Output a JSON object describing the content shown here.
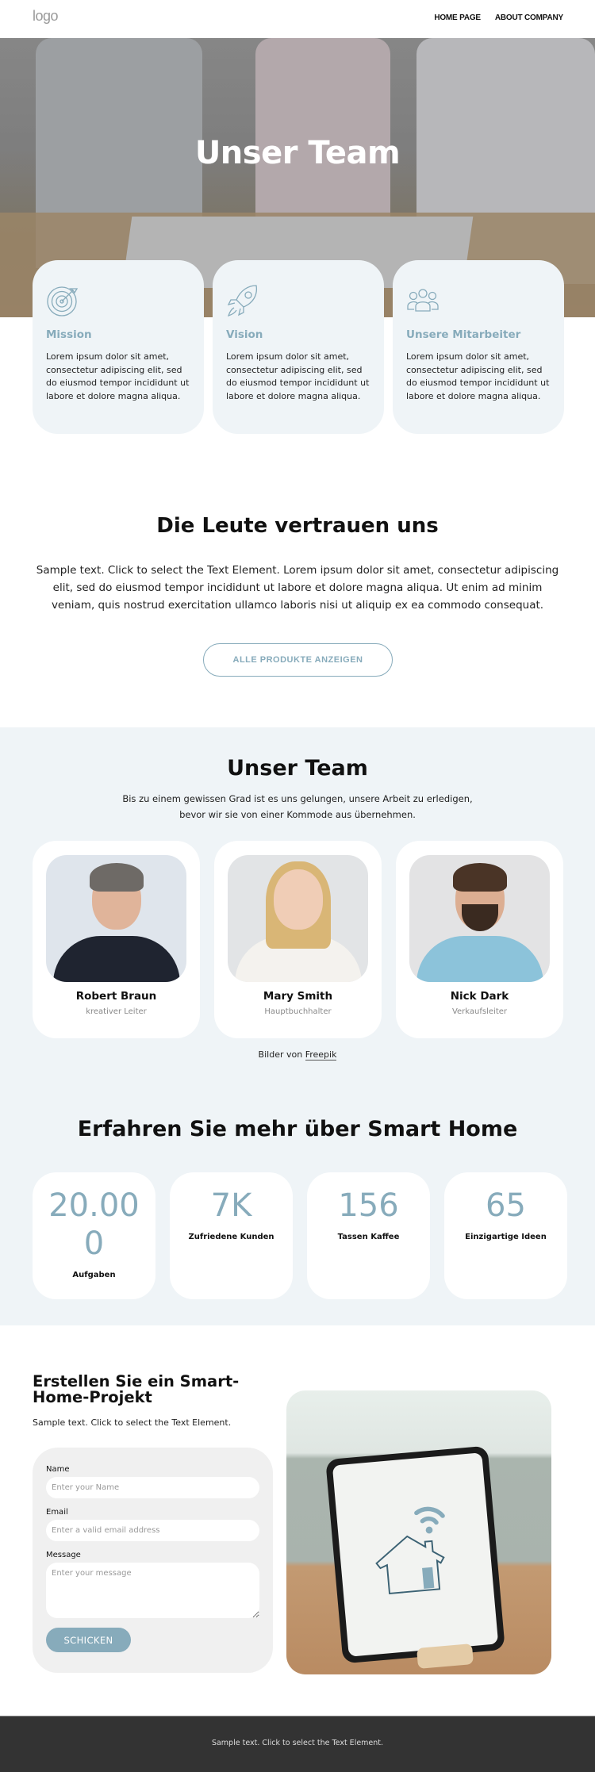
{
  "header": {
    "logo": "logo",
    "nav": [
      {
        "label": "HOME PAGE"
      },
      {
        "label": "ABOUT COMPANY"
      }
    ]
  },
  "hero": {
    "title": "Unser Team"
  },
  "features": [
    {
      "icon": "target-icon",
      "title": "Mission",
      "text": "Lorem ipsum dolor sit amet, consectetur adipiscing elit, sed do eiusmod tempor incididunt ut labore et dolore magna aliqua."
    },
    {
      "icon": "rocket-icon",
      "title": "Vision",
      "text": "Lorem ipsum dolor sit amet, consectetur adipiscing elit, sed do eiusmod tempor incididunt ut labore et dolore magna aliqua."
    },
    {
      "icon": "people-icon",
      "title": "Unsere Mitarbeiter",
      "text": "Lorem ipsum dolor sit amet, consectetur adipiscing elit, sed do eiusmod tempor incididunt ut labore et dolore magna aliqua."
    }
  ],
  "trust": {
    "title": "Die Leute vertrauen uns",
    "text": "Sample text. Click to select the Text Element. Lorem ipsum dolor sit amet, consectetur adipiscing elit, sed do eiusmod tempor incididunt ut labore et dolore magna aliqua. Ut enim ad minim veniam, quis nostrud exercitation ullamco laboris nisi ut aliquip ex ea commodo consequat.",
    "button_label": "ALLE PRODUKTE ANZEIGEN"
  },
  "team": {
    "title": "Unser Team",
    "subtitle": "Bis zu einem gewissen Grad ist es uns gelungen, unsere Arbeit zu erledigen, bevor wir sie von einer Kommode aus übernehmen.",
    "members": [
      {
        "name": "Robert Braun",
        "role": "kreativer Leiter"
      },
      {
        "name": "Mary Smith",
        "role": "Hauptbuchhalter"
      },
      {
        "name": "Nick Dark",
        "role": "Verkaufsleiter"
      }
    ],
    "credit_prefix": "Bilder von ",
    "credit_link": "Freepik"
  },
  "stats": {
    "title": "Erfahren Sie mehr über Smart Home",
    "items": [
      {
        "value": "20.000",
        "label": "Aufgaben"
      },
      {
        "value": "7K",
        "label": "Zufriedene Kunden"
      },
      {
        "value": "156",
        "label": "Tassen Kaffee"
      },
      {
        "value": "65",
        "label": "Einzigartige Ideen"
      }
    ]
  },
  "contact": {
    "title": "Erstellen Sie ein Smart-Home-Projekt",
    "subtitle": "Sample text. Click to select the Text Element.",
    "form": {
      "name_label": "Name",
      "name_placeholder": "Enter your Name",
      "email_label": "Email",
      "email_placeholder": "Enter a valid email address",
      "message_label": "Message",
      "message_placeholder": "Enter your message",
      "submit_label": "SCHICKEN"
    }
  },
  "footer": {
    "text": "Sample text. Click to select the Text Element."
  },
  "colors": {
    "accent": "#87abbb",
    "section_bg": "#eff4f7",
    "footer_bg": "#333333"
  }
}
